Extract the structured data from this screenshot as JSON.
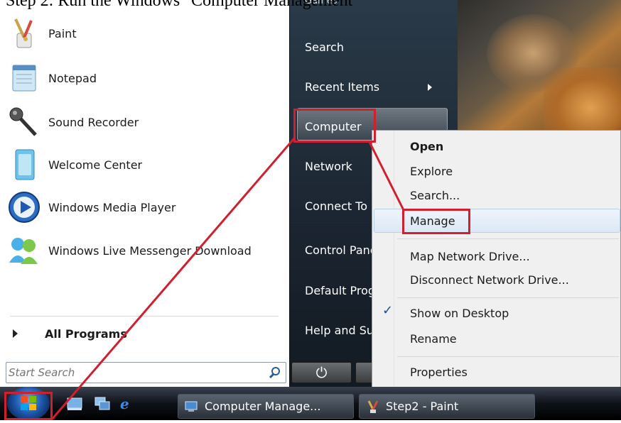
{
  "caption": "Step 2: Run the Windows \"Computer Management\"",
  "start_menu": {
    "programs": [
      {
        "label": "Paint",
        "icon": "paint-icon"
      },
      {
        "label": "Notepad",
        "icon": "notepad-icon"
      },
      {
        "label": "Sound Recorder",
        "icon": "microphone-icon"
      },
      {
        "label": "Welcome Center",
        "icon": "welcome-center-icon"
      },
      {
        "label": "Windows Media Player",
        "icon": "media-player-icon"
      },
      {
        "label": "Windows Live Messenger Download",
        "icon": "messenger-icon"
      }
    ],
    "all_programs": "All Programs",
    "search_placeholder": "Start Search"
  },
  "right_pane": {
    "partial_top": "Games",
    "items": [
      "Search",
      "Recent Items",
      "Computer",
      "Network",
      "Connect To",
      "Control Panel",
      "Default Programs",
      "Help and Support"
    ]
  },
  "context_menu": {
    "open": "Open",
    "explore": "Explore",
    "search": "Search...",
    "manage": "Manage",
    "map_drive": "Map Network Drive...",
    "disconnect_drive": "Disconnect Network Drive...",
    "show_desktop": "Show on Desktop",
    "rename": "Rename",
    "properties": "Properties"
  },
  "taskbar": {
    "buttons": [
      "Computer Manage...",
      "Step2 - Paint"
    ]
  },
  "colors": {
    "annotation": "#d01f2f",
    "taskbar": "#0e1218",
    "start_right_pane": "#1c2632"
  }
}
